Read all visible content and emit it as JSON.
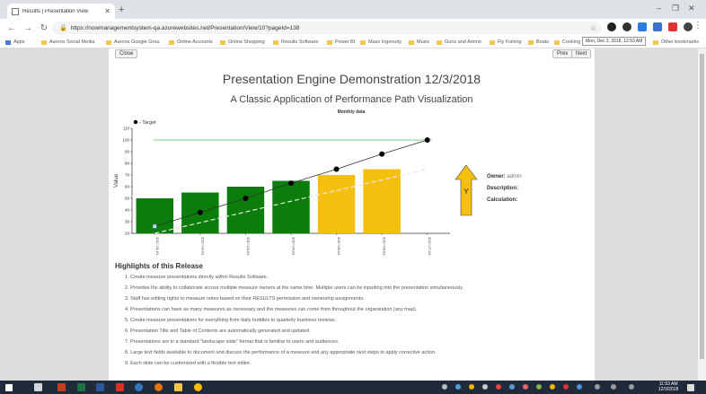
{
  "browser": {
    "tab_title": "Results | Presentation View",
    "url": "https://nowmanagementsystem-qa.azurewebsites.net/Presentation/View/10?pageId=138",
    "bookmarks": [
      "Apps",
      "Aarons Social Media",
      "Aarons Google Grou",
      "Online Accounts",
      "Online Shopping",
      "Results Software",
      "Power BI",
      "Mass Ingenuity",
      "Music",
      "Guns and Ammo",
      "Fly Fishing",
      "Boats",
      "Cooking"
    ],
    "other_bookmarks": "Other bookmarks",
    "colors": {
      "tabstrip": "#dee1e6",
      "taskbar": "#1f2a3a"
    }
  },
  "page": {
    "close_label": "Close",
    "prev_label": "Prev",
    "next_label": "Next",
    "title": "Presentation Engine Demonstration 12/3/2018",
    "subtitle": "A Classic Application of Performance Path Visualization",
    "timestamp": "Mon, Dec 3, 2018, 12:53 AM",
    "owner_label": "Owner:",
    "owner_value": "admin",
    "description_label": "Description:",
    "calculation_label": "Calculation:",
    "arrow_letter": "Y",
    "highlights_title": "Highlights of this Release",
    "highlights": [
      "1.   Create measure presentations directly within Results Software.",
      "2.   Provides the ability to collaborate across multiple measure owners at the same time. Multiple users can be inputting into the presentation simultaneously.",
      "3.   Staff has editing rights to measure notes based on their RESULTS permission and ownership assignments.",
      "4.   Presentations can have as many measures as necessary and the measures can come from throughout the organization (any map).",
      "5.   Create measure presentations for everything from daily huddles to quarterly business reviews.",
      "6.   Presentation Title and Table of Contents are automatically generated and updated.",
      "7.   Presentations are in a standard \"landscape slide\" format that is familiar to users and audiences.",
      "8.   Large text fields available to document and discuss the performance of a measure and any appropriate next steps to apply corrective action.",
      "9.   Each slide can be customized with a flexible text editor."
    ]
  },
  "taskbar": {
    "time": "11:53 AM",
    "date": "12/3/2018"
  },
  "chart_data": {
    "type": "bar",
    "title": "Monthly data",
    "ylabel": "Value",
    "legend": "- Target",
    "ylim": [
      20,
      100
    ],
    "yticks": [
      20,
      30,
      40,
      50,
      60,
      70,
      80,
      90,
      100,
      110
    ],
    "categories": [
      "2017-01-01",
      "2017-02-01",
      "2017-03-01",
      "2017-04-01",
      "2017-05-01",
      "2017-06-01",
      "2017-07-01"
    ],
    "values": [
      50,
      55,
      60,
      65,
      70,
      75,
      null
    ],
    "bar_colors": [
      "#0a7d0a",
      "#0a7d0a",
      "#0a7d0a",
      "#0a7d0a",
      "#f5bf0f",
      "#f5bf0f",
      null
    ],
    "target": [
      null,
      38,
      50,
      63,
      75,
      88,
      100
    ],
    "target_line": 100,
    "trend_start": 20,
    "trend_end": 75,
    "first_point": 26,
    "colors": {
      "green": "#0a7d0a",
      "yellow": "#f5bf0f",
      "target_line": "#7fd37f",
      "arrow": "#f5bf0f"
    }
  }
}
